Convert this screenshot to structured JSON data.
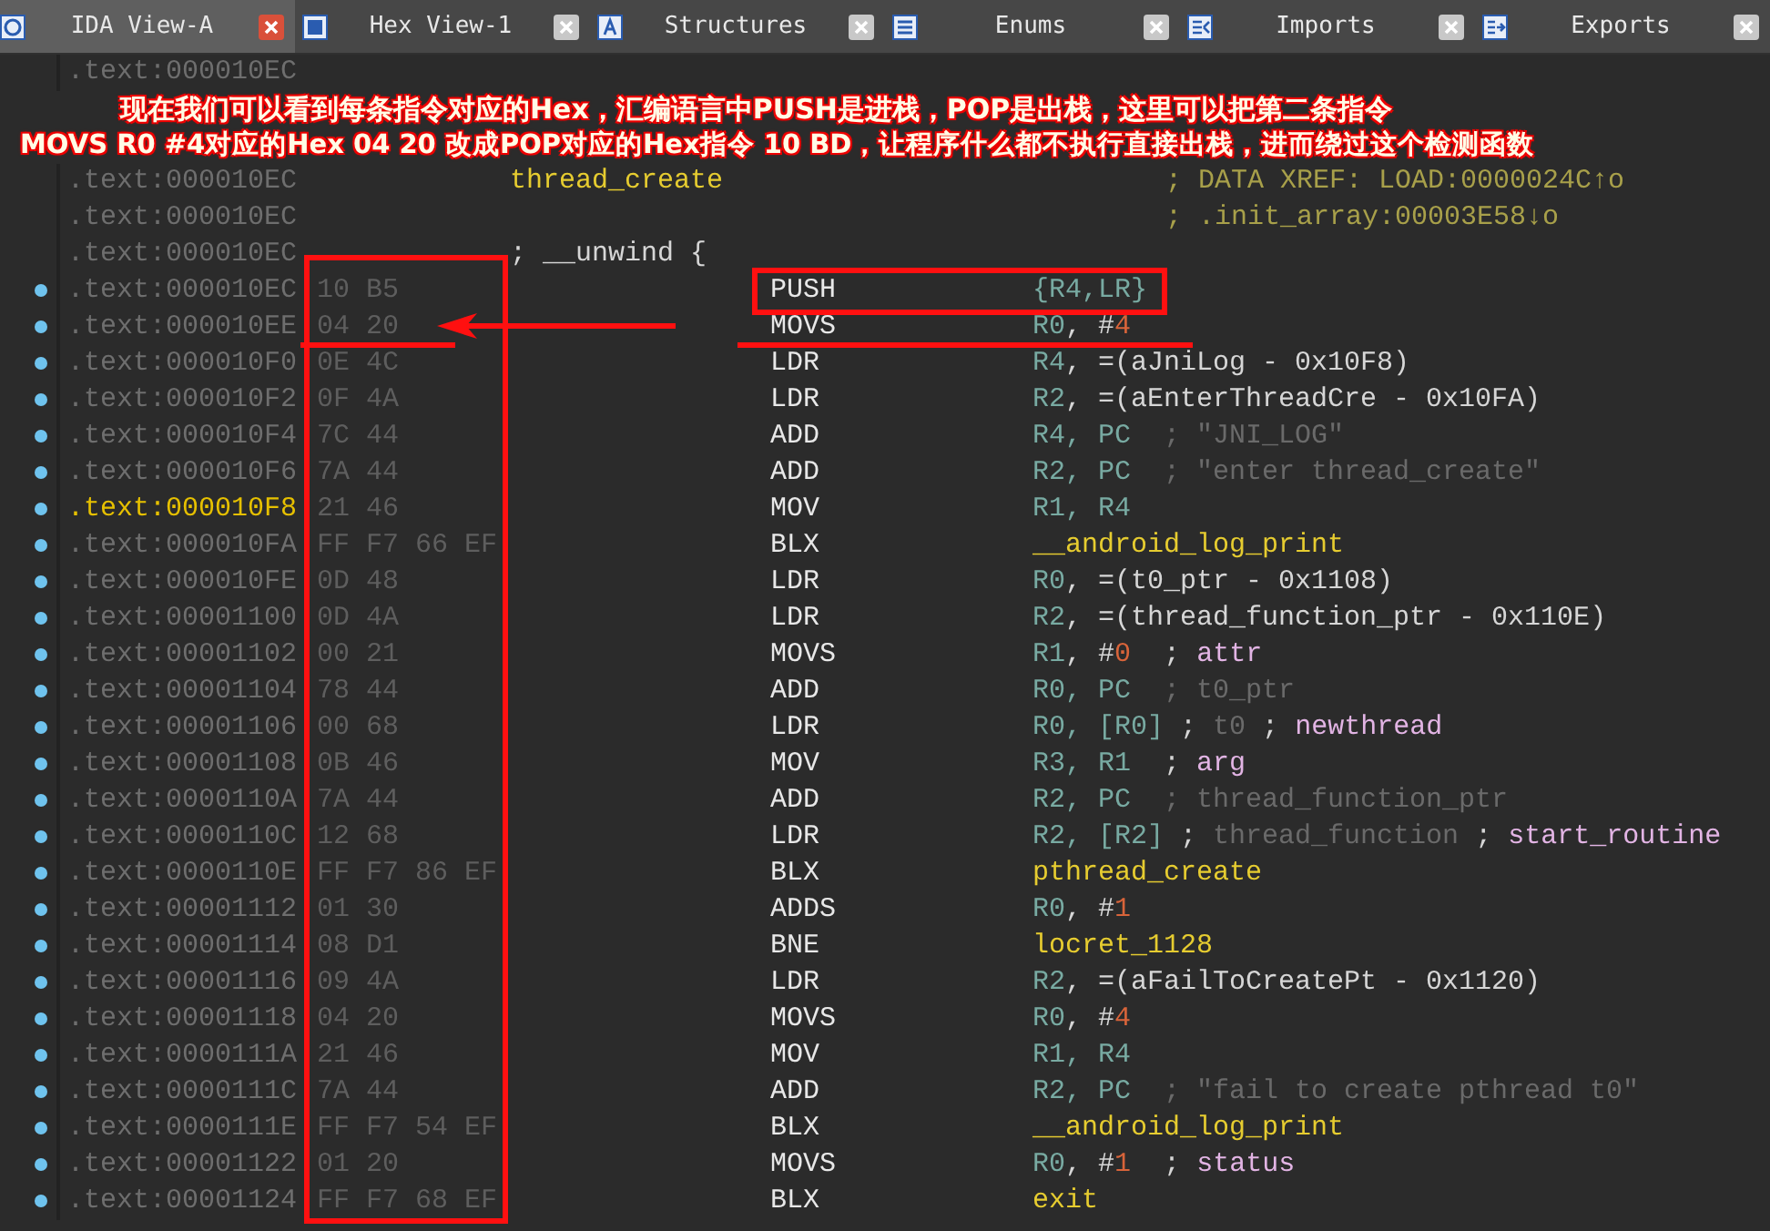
{
  "tabs": [
    {
      "label": "IDA View-A",
      "kind": "ida",
      "selected": true
    },
    {
      "label": "Hex View-1",
      "kind": "hex",
      "selected": false
    },
    {
      "label": "Structures",
      "kind": "struct",
      "selected": false
    },
    {
      "label": "Enums",
      "kind": "enum",
      "selected": false
    },
    {
      "label": "Imports",
      "kind": "imports",
      "selected": false
    },
    {
      "label": "Exports",
      "kind": "exports",
      "selected": false
    }
  ],
  "top_row": {
    "address": ".text:000010EC"
  },
  "annotation": [
    "现在我们可以看到每条指令对应的Hex，汇编语言中PUSH是进栈，POP是出栈，这里可以把第二条指令",
    "MOVS R0 #4对应的Hex 04 20 改成POP对应的Hex指令 10 BD，让程序什么都不执行直接出栈，进而绕过这个检测函数"
  ],
  "header_rows": [
    {
      "address": ".text:000010EC",
      "kind": "symbol",
      "label": "thread_create",
      "xref": "; DATA XREF: LOAD:0000024C↑o"
    },
    {
      "address": ".text:000010EC",
      "kind": "xref",
      "xref": "; .init_array:00003E58↓o"
    },
    {
      "address": ".text:000010EC",
      "kind": "block",
      "label": "; __unwind {"
    }
  ],
  "rows": [
    {
      "address": ".text:000010EC",
      "dot": true,
      "current": false,
      "bytes": "10 B5",
      "mnemonic": "PUSH",
      "operands": [
        {
          "text": "{R4,LR}",
          "kind": "reg"
        }
      ]
    },
    {
      "address": ".text:000010EE",
      "dot": true,
      "current": false,
      "bytes": "04 20",
      "mnemonic": "MOVS",
      "operands": [
        {
          "text": "R0",
          "kind": "reg"
        },
        {
          "text": ", #",
          "kind": "plain"
        },
        {
          "text": "4",
          "kind": "imm"
        }
      ]
    },
    {
      "address": ".text:000010F0",
      "dot": true,
      "current": false,
      "bytes": "0E 4C",
      "mnemonic": "LDR",
      "operands": [
        {
          "text": "R4",
          "kind": "reg"
        },
        {
          "text": ", =(aJniLog - 0x10F8)",
          "kind": "plain"
        }
      ]
    },
    {
      "address": ".text:000010F2",
      "dot": true,
      "current": false,
      "bytes": "0F 4A",
      "mnemonic": "LDR",
      "operands": [
        {
          "text": "R2",
          "kind": "reg"
        },
        {
          "text": ", =(aEnterThreadCre - 0x10FA)",
          "kind": "plain"
        }
      ]
    },
    {
      "address": ".text:000010F4",
      "dot": true,
      "current": false,
      "bytes": "7C 44",
      "mnemonic": "ADD",
      "operands": [
        {
          "text": "R4, PC",
          "kind": "reg"
        },
        {
          "text": "  ; \"JNI_LOG\"",
          "kind": "cmt"
        }
      ]
    },
    {
      "address": ".text:000010F6",
      "dot": true,
      "current": false,
      "bytes": "7A 44",
      "mnemonic": "ADD",
      "operands": [
        {
          "text": "R2, PC",
          "kind": "reg"
        },
        {
          "text": "  ; \"enter thread_create\"",
          "kind": "cmt"
        }
      ]
    },
    {
      "address": ".text:000010F8",
      "dot": true,
      "current": true,
      "bytes": "21 46",
      "mnemonic": "MOV",
      "operands": [
        {
          "text": "R1, R4",
          "kind": "reg"
        }
      ]
    },
    {
      "address": ".text:000010FA",
      "dot": true,
      "current": false,
      "bytes": "FF F7 66 EF",
      "mnemonic": "BLX",
      "operands": [
        {
          "text": "__android_log_print",
          "kind": "sym"
        }
      ]
    },
    {
      "address": ".text:000010FE",
      "dot": true,
      "current": false,
      "bytes": "0D 48",
      "mnemonic": "LDR",
      "operands": [
        {
          "text": "R0",
          "kind": "reg"
        },
        {
          "text": ", =(t0_ptr - 0x1108)",
          "kind": "plain"
        }
      ]
    },
    {
      "address": ".text:00001100",
      "dot": true,
      "current": false,
      "bytes": "0D 4A",
      "mnemonic": "LDR",
      "operands": [
        {
          "text": "R2",
          "kind": "reg"
        },
        {
          "text": ", =(thread_function_ptr - 0x110E)",
          "kind": "plain"
        }
      ]
    },
    {
      "address": ".text:00001102",
      "dot": true,
      "current": false,
      "bytes": "00 21",
      "mnemonic": "MOVS",
      "operands": [
        {
          "text": "R1",
          "kind": "reg"
        },
        {
          "text": ", #",
          "kind": "plain"
        },
        {
          "text": "0",
          "kind": "imm"
        },
        {
          "text": "  ; ",
          "kind": "plain"
        },
        {
          "text": "attr",
          "kind": "note"
        }
      ]
    },
    {
      "address": ".text:00001104",
      "dot": true,
      "current": false,
      "bytes": "78 44",
      "mnemonic": "ADD",
      "operands": [
        {
          "text": "R0, PC",
          "kind": "reg"
        },
        {
          "text": "  ; t0_ptr",
          "kind": "cmt"
        }
      ]
    },
    {
      "address": ".text:00001106",
      "dot": true,
      "current": false,
      "bytes": "00 68",
      "mnemonic": "LDR",
      "operands": [
        {
          "text": "R0, [R0]",
          "kind": "reg"
        },
        {
          "text": " ; ",
          "kind": "plain"
        },
        {
          "text": "t0",
          "kind": "cmt"
        },
        {
          "text": " ; ",
          "kind": "plain"
        },
        {
          "text": "newthread",
          "kind": "note"
        }
      ]
    },
    {
      "address": ".text:00001108",
      "dot": true,
      "current": false,
      "bytes": "0B 46",
      "mnemonic": "MOV",
      "operands": [
        {
          "text": "R3, R1",
          "kind": "reg"
        },
        {
          "text": "  ; ",
          "kind": "plain"
        },
        {
          "text": "arg",
          "kind": "note"
        }
      ]
    },
    {
      "address": ".text:0000110A",
      "dot": true,
      "current": false,
      "bytes": "7A 44",
      "mnemonic": "ADD",
      "operands": [
        {
          "text": "R2, PC",
          "kind": "reg"
        },
        {
          "text": "  ; thread_function_ptr",
          "kind": "cmt"
        }
      ]
    },
    {
      "address": ".text:0000110C",
      "dot": true,
      "current": false,
      "bytes": "12 68",
      "mnemonic": "LDR",
      "operands": [
        {
          "text": "R2, [R2]",
          "kind": "reg"
        },
        {
          "text": " ; ",
          "kind": "plain"
        },
        {
          "text": "thread_function",
          "kind": "cmt"
        },
        {
          "text": " ; ",
          "kind": "plain"
        },
        {
          "text": "start_routine",
          "kind": "note"
        }
      ]
    },
    {
      "address": ".text:0000110E",
      "dot": true,
      "current": false,
      "bytes": "FF F7 86 EF",
      "mnemonic": "BLX",
      "operands": [
        {
          "text": "pthread_create",
          "kind": "sym"
        }
      ]
    },
    {
      "address": ".text:00001112",
      "dot": true,
      "current": false,
      "bytes": "01 30",
      "mnemonic": "ADDS",
      "operands": [
        {
          "text": "R0",
          "kind": "reg"
        },
        {
          "text": ", #",
          "kind": "plain"
        },
        {
          "text": "1",
          "kind": "imm"
        }
      ]
    },
    {
      "address": ".text:00001114",
      "dot": true,
      "current": false,
      "bytes": "08 D1",
      "mnemonic": "BNE",
      "operands": [
        {
          "text": "locret_1128",
          "kind": "sym"
        }
      ]
    },
    {
      "address": ".text:00001116",
      "dot": true,
      "current": false,
      "bytes": "09 4A",
      "mnemonic": "LDR",
      "operands": [
        {
          "text": "R2",
          "kind": "reg"
        },
        {
          "text": ", =(aFailToCreatePt - 0x1120)",
          "kind": "plain"
        }
      ]
    },
    {
      "address": ".text:00001118",
      "dot": true,
      "current": false,
      "bytes": "04 20",
      "mnemonic": "MOVS",
      "operands": [
        {
          "text": "R0",
          "kind": "reg"
        },
        {
          "text": ", #",
          "kind": "plain"
        },
        {
          "text": "4",
          "kind": "imm"
        }
      ]
    },
    {
      "address": ".text:0000111A",
      "dot": true,
      "current": false,
      "bytes": "21 46",
      "mnemonic": "MOV",
      "operands": [
        {
          "text": "R1, R4",
          "kind": "reg"
        }
      ]
    },
    {
      "address": ".text:0000111C",
      "dot": true,
      "current": false,
      "bytes": "7A 44",
      "mnemonic": "ADD",
      "operands": [
        {
          "text": "R2, PC",
          "kind": "reg"
        },
        {
          "text": "  ; \"fail to create pthread t0\"",
          "kind": "cmt"
        }
      ]
    },
    {
      "address": ".text:0000111E",
      "dot": true,
      "current": false,
      "bytes": "FF F7 54 EF",
      "mnemonic": "BLX",
      "operands": [
        {
          "text": "__android_log_print",
          "kind": "sym"
        }
      ]
    },
    {
      "address": ".text:00001122",
      "dot": true,
      "current": false,
      "bytes": "01 20",
      "mnemonic": "MOVS",
      "operands": [
        {
          "text": "R0",
          "kind": "reg"
        },
        {
          "text": ", #",
          "kind": "plain"
        },
        {
          "text": "1",
          "kind": "imm"
        },
        {
          "text": "  ; ",
          "kind": "plain"
        },
        {
          "text": "status",
          "kind": "note"
        }
      ]
    },
    {
      "address": ".text:00001124",
      "dot": true,
      "current": false,
      "bytes": "FF F7 68 EF",
      "mnemonic": "BLX",
      "operands": [
        {
          "text": "exit",
          "kind": "sym"
        }
      ]
    }
  ]
}
